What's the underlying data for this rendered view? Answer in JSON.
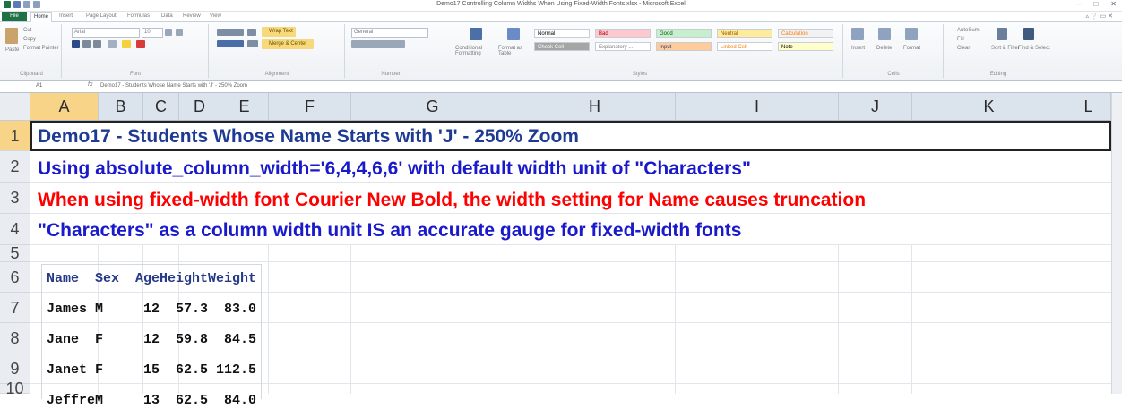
{
  "window": {
    "title": "Demo17 Controlling Column Widths When Using Fixed-Width Fonts.xlsx - Microsoft Excel",
    "controls": [
      "–",
      "□",
      "✕"
    ]
  },
  "ribbon_tabs": [
    "File",
    "Home",
    "Insert",
    "Page Layout",
    "Formulas",
    "Data",
    "Review",
    "View"
  ],
  "ribbon": {
    "clipboard": {
      "paste": "Paste",
      "cut": "Cut",
      "copy": "Copy",
      "format_painter": "Format Painter",
      "label": "Clipboard"
    },
    "font": {
      "name": "Arial",
      "size": "10",
      "label": "Font"
    },
    "alignment": {
      "wrap": "Wrap Text",
      "merge": "Merge & Center",
      "label": "Alignment"
    },
    "number": {
      "format": "General",
      "label": "Number"
    },
    "styles": {
      "label": "Styles",
      "cond": "Conditional Formatting",
      "format_table": "Format as Table",
      "cells": [
        {
          "label": "Normal",
          "bg": "#ffffff",
          "fg": "#000000"
        },
        {
          "label": "Bad",
          "bg": "#ffc7ce",
          "fg": "#9c0006"
        },
        {
          "label": "Good",
          "bg": "#c6efce",
          "fg": "#006100"
        },
        {
          "label": "Neutral",
          "bg": "#ffeb9c",
          "fg": "#9c5700"
        },
        {
          "label": "Calculation",
          "bg": "#f2f2f2",
          "fg": "#fa7d00"
        },
        {
          "label": "Check Cell",
          "bg": "#a5a5a5",
          "fg": "#ffffff"
        },
        {
          "label": "Explanatory ...",
          "bg": "#ffffff",
          "fg": "#7f7f7f"
        },
        {
          "label": "Input",
          "bg": "#ffcc99",
          "fg": "#3f3f76"
        },
        {
          "label": "Linked Cell",
          "bg": "#ffffff",
          "fg": "#fa7d00"
        },
        {
          "label": "Note",
          "bg": "#ffffcc",
          "fg": "#000000"
        }
      ]
    },
    "cells": {
      "insert": "Insert",
      "delete": "Delete",
      "format": "Format",
      "label": "Cells"
    },
    "editing": {
      "autosum": "AutoSum",
      "fill": "Fill",
      "clear": "Clear",
      "sort": "Sort & Filter",
      "find": "Find & Select",
      "label": "Editing"
    }
  },
  "formula_bar": {
    "cell_ref": "A1",
    "fx": "fx",
    "content": "Demo17 - Students Whose Name Starts with 'J' - 250% Zoom"
  },
  "columns": [
    "A",
    "B",
    "C",
    "D",
    "E",
    "F",
    "G",
    "H",
    "I",
    "J",
    "K",
    "L"
  ],
  "rows": [
    "1",
    "2",
    "3",
    "4",
    "5",
    "6",
    "7",
    "8",
    "9",
    "10"
  ],
  "sheet": {
    "line1": "Demo17 - Students Whose Name Starts with 'J' - 250% Zoom",
    "line2": "Using absolute_column_width='6,4,4,6,6' with default width unit of \"Characters\"",
    "line3": "When using fixed-width font Courier New Bold, the width setting for Name causes truncation",
    "line4": "\"Characters\" as a column width unit IS an accurate gauge for fixed-width fonts",
    "colors": {
      "title": "#1f3a93",
      "blue": "#1a1acb",
      "red": "#ff0000"
    },
    "table": {
      "headers": [
        "Name",
        "Sex",
        "Age",
        "Height",
        "Weight"
      ],
      "rows": [
        [
          "James",
          "M",
          "12",
          "57.3",
          "83.0"
        ],
        [
          "Jane",
          "F",
          "12",
          "59.8",
          "84.5"
        ],
        [
          "Janet",
          "F",
          "15",
          "62.5",
          "112.5"
        ],
        [
          "Jeffre",
          "M",
          "13",
          "62.5",
          "84.0"
        ]
      ]
    }
  }
}
